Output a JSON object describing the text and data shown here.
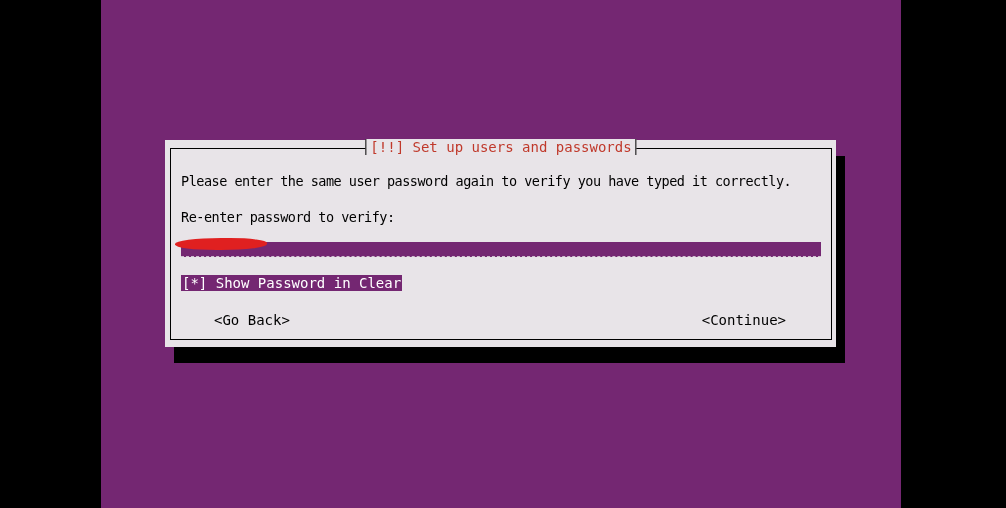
{
  "dialog": {
    "title": "[!!] Set up users and passwords",
    "message": "Please enter the same user password again to verify you have typed it correctly.",
    "field_label": "Re-enter password to verify:",
    "password_field": {
      "redacted": true
    },
    "checkbox": {
      "box": "[*]",
      "label": "Show Password in Clear",
      "selected": true
    },
    "buttons": [
      {
        "label": "<Go Back>",
        "selected": false
      },
      {
        "label": "<Continue>",
        "selected": false
      }
    ]
  }
}
